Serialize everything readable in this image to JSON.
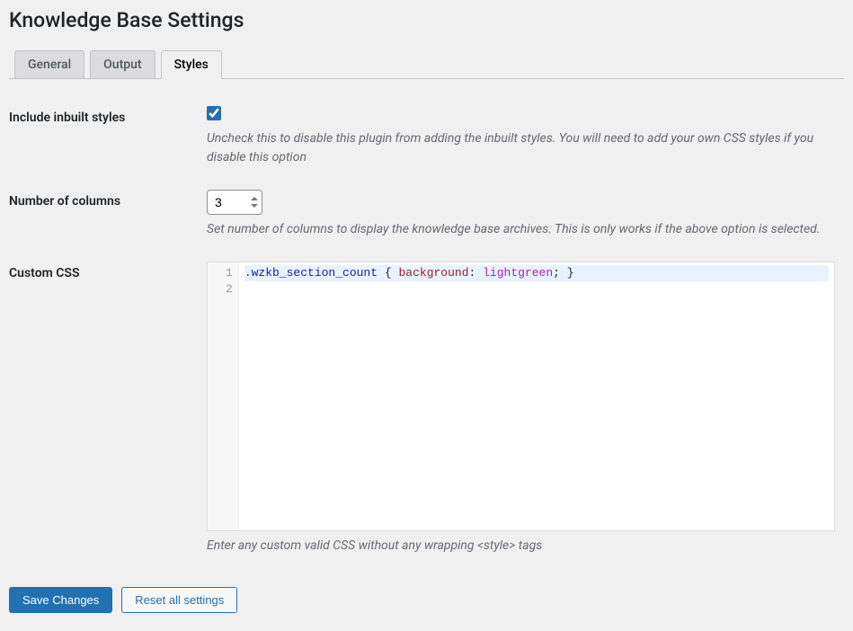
{
  "page_title": "Knowledge Base Settings",
  "tabs": [
    {
      "label": "General",
      "active": false
    },
    {
      "label": "Output",
      "active": false
    },
    {
      "label": "Styles",
      "active": true
    }
  ],
  "fields": {
    "include_styles": {
      "label": "Include inbuilt styles",
      "checked": true,
      "desc": "Uncheck this to disable this plugin from adding the inbuilt styles. You will need to add your own CSS styles if you disable this option"
    },
    "columns": {
      "label": "Number of columns",
      "value": "3",
      "desc": "Set number of columns to display the knowledge base archives. This is only works if the above option is selected."
    },
    "custom_css": {
      "label": "Custom CSS",
      "lines": [
        "1",
        "2"
      ],
      "code_tokens": {
        "selector": ".wzkb_section_count",
        "ob": "{",
        "prop": "background",
        "colon": ":",
        "value": "lightgreen",
        "semi": ";",
        "cb": "}"
      },
      "desc": "Enter any custom valid CSS without any wrapping <style> tags"
    }
  },
  "buttons": {
    "save": "Save Changes",
    "reset": "Reset all settings"
  }
}
